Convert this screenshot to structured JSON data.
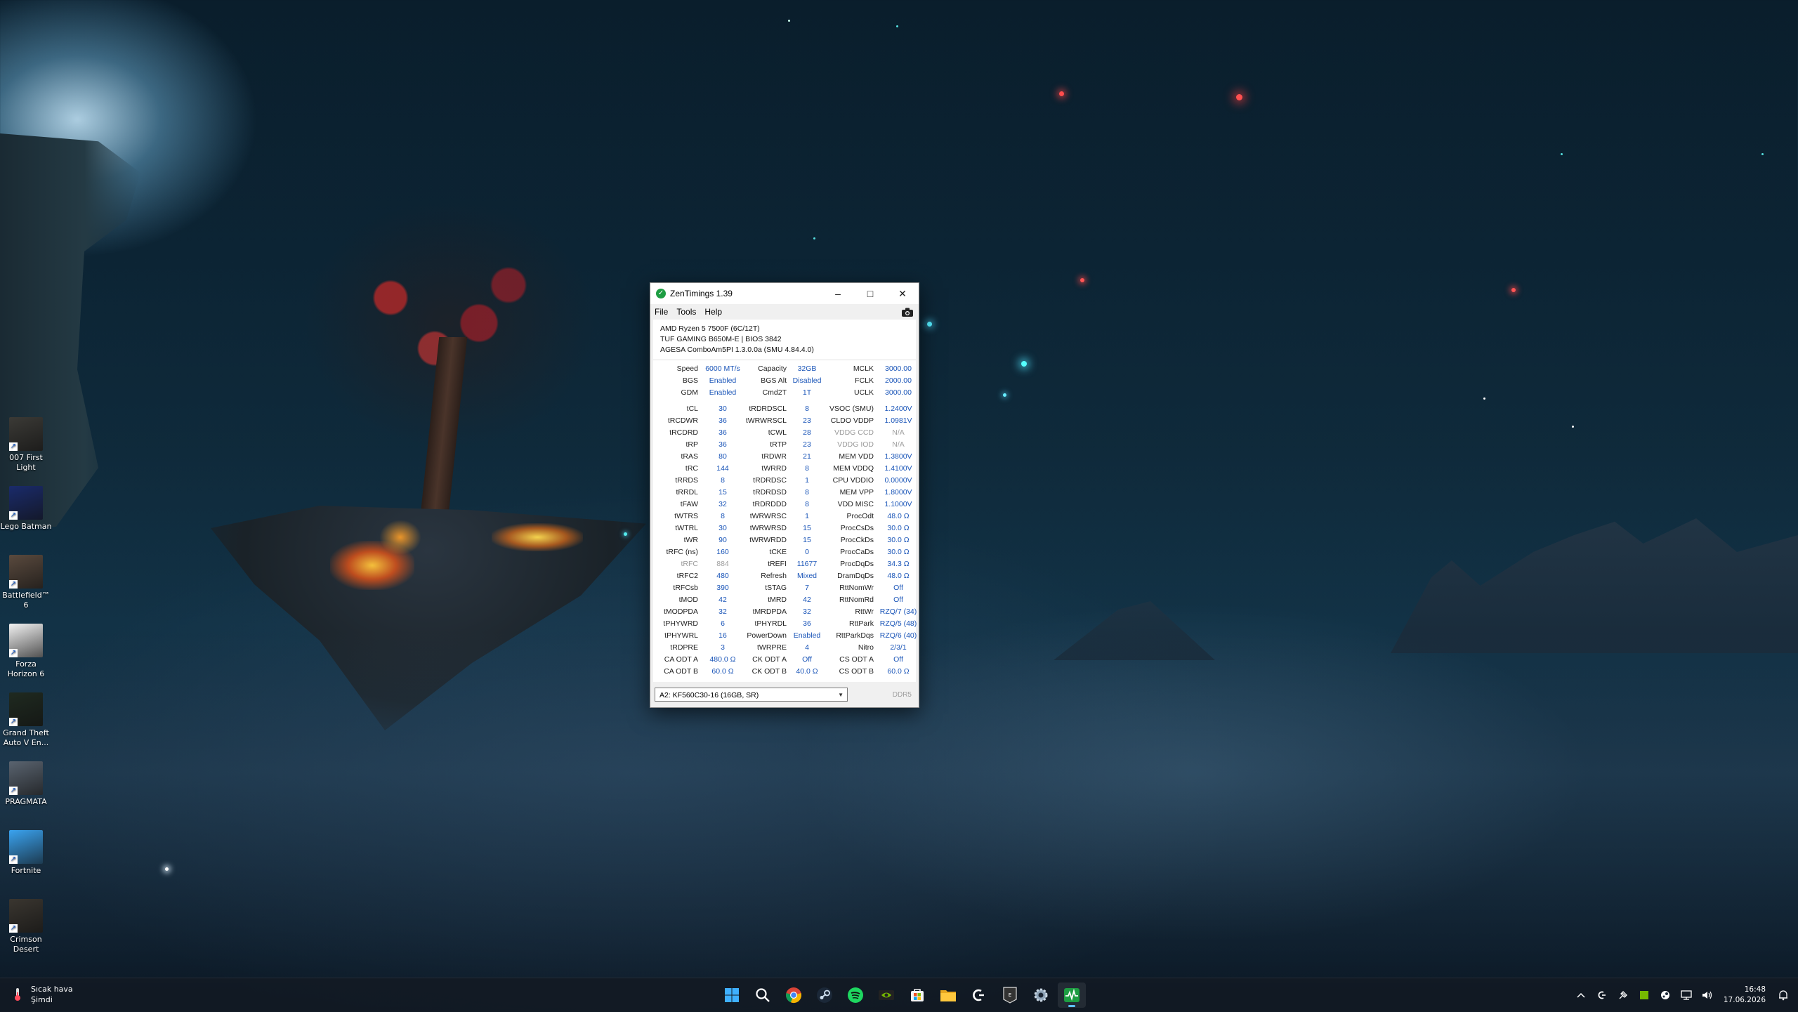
{
  "desktop": {
    "icons": [
      {
        "label": "007 First Light",
        "color": "#3b3a36"
      },
      {
        "label": "Lego Batman",
        "color": "#1a2b6b"
      },
      {
        "label": "Battlefield™ 6",
        "color": "#5a4a3e"
      },
      {
        "label": "Forza Horizon 6",
        "color": "#f2f2f2"
      },
      {
        "label": "Grand Theft Auto V En...",
        "color": "#1f2a20"
      },
      {
        "label": "PRAGMATA",
        "color": "#5a6470"
      },
      {
        "label": "Fortnite",
        "color": "#3aa3f0"
      },
      {
        "label": "Crimson Desert",
        "color": "#3a3630"
      }
    ]
  },
  "window": {
    "title": "ZenTimings 1.39",
    "controls": {
      "minimize": "–",
      "maximize": "□",
      "close": "✕"
    },
    "menu": [
      "File",
      "Tools",
      "Help"
    ],
    "system": {
      "cpu": "AMD Ryzen 5 7500F (6C/12T)",
      "board": "TUF GAMING B650M-E | BIOS 3842",
      "agesa": "AGESA ComboAm5PI 1.3.0.0a (SMU 4.84.4.0)"
    },
    "rows_top": [
      [
        {
          "l": "Speed",
          "v": "6000 MT/s"
        },
        {
          "l": "Capacity",
          "v": "32GB"
        },
        {
          "l": "MCLK",
          "v": "3000.00"
        }
      ],
      [
        {
          "l": "BGS",
          "v": "Enabled"
        },
        {
          "l": "BGS Alt",
          "v": "Disabled"
        },
        {
          "l": "FCLK",
          "v": "2000.00"
        }
      ],
      [
        {
          "l": "GDM",
          "v": "Enabled"
        },
        {
          "l": "Cmd2T",
          "v": "1T"
        },
        {
          "l": "UCLK",
          "v": "3000.00"
        }
      ]
    ],
    "rows_main": [
      [
        {
          "l": "tCL",
          "v": "30"
        },
        {
          "l": "tRDRDSCL",
          "v": "8"
        },
        {
          "l": "VSOC (SMU)",
          "v": "1.2400V"
        }
      ],
      [
        {
          "l": "tRCDWR",
          "v": "36"
        },
        {
          "l": "tWRWRSCL",
          "v": "23"
        },
        {
          "l": "CLDO VDDP",
          "v": "1.0981V"
        }
      ],
      [
        {
          "l": "tRCDRD",
          "v": "36"
        },
        {
          "l": "tCWL",
          "v": "28"
        },
        {
          "l": "VDDG CCD",
          "v": "N/A",
          "dim": true
        }
      ],
      [
        {
          "l": "tRP",
          "v": "36"
        },
        {
          "l": "tRTP",
          "v": "23"
        },
        {
          "l": "VDDG IOD",
          "v": "N/A",
          "dim": true
        }
      ],
      [
        {
          "l": "tRAS",
          "v": "80"
        },
        {
          "l": "tRDWR",
          "v": "21"
        },
        {
          "l": "MEM VDD",
          "v": "1.3800V"
        }
      ],
      [
        {
          "l": "tRC",
          "v": "144"
        },
        {
          "l": "tWRRD",
          "v": "8"
        },
        {
          "l": "MEM VDDQ",
          "v": "1.4100V"
        }
      ],
      [
        {
          "l": "tRRDS",
          "v": "8"
        },
        {
          "l": "tRDRDSC",
          "v": "1"
        },
        {
          "l": "CPU VDDIO",
          "v": "0.0000V"
        }
      ],
      [
        {
          "l": "tRRDL",
          "v": "15"
        },
        {
          "l": "tRDRDSD",
          "v": "8"
        },
        {
          "l": "MEM VPP",
          "v": "1.8000V"
        }
      ],
      [
        {
          "l": "tFAW",
          "v": "32"
        },
        {
          "l": "tRDRDDD",
          "v": "8"
        },
        {
          "l": "VDD MISC",
          "v": "1.1000V"
        }
      ],
      [
        {
          "l": "tWTRS",
          "v": "8"
        },
        {
          "l": "tWRWRSC",
          "v": "1"
        },
        {
          "l": "ProcOdt",
          "v": "48.0 Ω"
        }
      ],
      [
        {
          "l": "tWTRL",
          "v": "30"
        },
        {
          "l": "tWRWRSD",
          "v": "15"
        },
        {
          "l": "ProcCsDs",
          "v": "30.0 Ω"
        }
      ],
      [
        {
          "l": "tWR",
          "v": "90"
        },
        {
          "l": "tWRWRDD",
          "v": "15"
        },
        {
          "l": "ProcCkDs",
          "v": "30.0 Ω"
        }
      ],
      [
        {
          "l": "tRFC (ns)",
          "v": "160"
        },
        {
          "l": "tCKE",
          "v": "0"
        },
        {
          "l": "ProcCaDs",
          "v": "30.0 Ω"
        }
      ],
      [
        {
          "l": "tRFC",
          "v": "884",
          "dim": true
        },
        {
          "l": "tREFI",
          "v": "11677"
        },
        {
          "l": "ProcDqDs",
          "v": "34.3 Ω"
        }
      ],
      [
        {
          "l": "tRFC2",
          "v": "480"
        },
        {
          "l": "Refresh",
          "v": "Mixed"
        },
        {
          "l": "DramDqDs",
          "v": "48.0 Ω"
        }
      ],
      [
        {
          "l": "tRFCsb",
          "v": "390"
        },
        {
          "l": "tSTAG",
          "v": "7"
        },
        {
          "l": "RttNomWr",
          "v": "Off"
        }
      ],
      [
        {
          "l": "tMOD",
          "v": "42"
        },
        {
          "l": "tMRD",
          "v": "42"
        },
        {
          "l": "RttNomRd",
          "v": "Off"
        }
      ],
      [
        {
          "l": "tMODPDA",
          "v": "32"
        },
        {
          "l": "tMRDPDA",
          "v": "32"
        },
        {
          "l": "RttWr",
          "v": "RZQ/7 (34)"
        }
      ],
      [
        {
          "l": "tPHYWRD",
          "v": "6"
        },
        {
          "l": "tPHYRDL",
          "v": "36"
        },
        {
          "l": "RttPark",
          "v": "RZQ/5 (48)"
        }
      ],
      [
        {
          "l": "tPHYWRL",
          "v": "16"
        },
        {
          "l": "PowerDown",
          "v": "Enabled"
        },
        {
          "l": "RttParkDqs",
          "v": "RZQ/6 (40)"
        }
      ],
      [
        {
          "l": "tRDPRE",
          "v": "3"
        },
        {
          "l": "tWRPRE",
          "v": "4"
        },
        {
          "l": "Nitro",
          "v": "2/3/1"
        }
      ],
      [
        {
          "l": "CA ODT A",
          "v": "480.0 Ω"
        },
        {
          "l": "CK ODT A",
          "v": "Off"
        },
        {
          "l": "CS ODT A",
          "v": "Off"
        }
      ],
      [
        {
          "l": "CA ODT B",
          "v": "60.0 Ω"
        },
        {
          "l": "CK ODT B",
          "v": "40.0 Ω"
        },
        {
          "l": "CS ODT B",
          "v": "60.0 Ω"
        }
      ]
    ],
    "module_select": "A2: KF560C30-16 (16GB, SR)",
    "mem_type": "DDR5"
  },
  "taskbar": {
    "weather_title": "Sıcak hava",
    "weather_sub": "Şimdi",
    "apps": [
      {
        "name": "start-icon",
        "active": false
      },
      {
        "name": "search-icon",
        "active": false
      },
      {
        "name": "chrome-icon",
        "active": false
      },
      {
        "name": "steam-icon",
        "active": false
      },
      {
        "name": "spotify-icon",
        "active": false
      },
      {
        "name": "nvidia-icon",
        "active": false
      },
      {
        "name": "store-icon",
        "active": false
      },
      {
        "name": "file-explorer-icon",
        "active": false
      },
      {
        "name": "logitech-icon",
        "active": false
      },
      {
        "name": "epic-icon",
        "active": false
      },
      {
        "name": "settings-icon",
        "active": false
      },
      {
        "name": "zentimings-icon",
        "active": true
      }
    ],
    "time": "16:48",
    "date": "17.06.2026"
  },
  "colors": {
    "accent": "#1a55b8",
    "taskbar_indicator": "#5dc1ff"
  }
}
